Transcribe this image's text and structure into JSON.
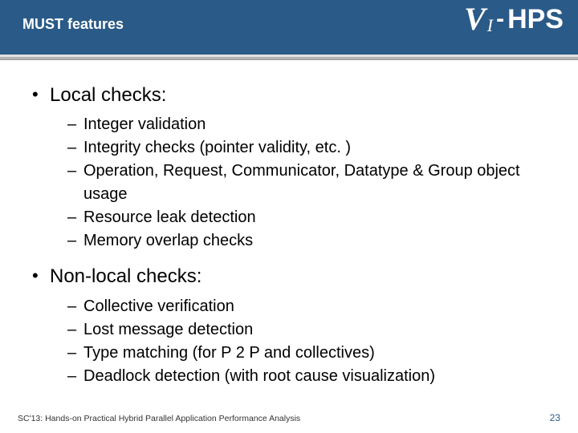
{
  "header": {
    "title": "MUST features",
    "logo": {
      "v": "V",
      "i": "I",
      "dash": "-",
      "hps": "HPS"
    }
  },
  "bullets": {
    "local": {
      "title": "Local checks:",
      "items": [
        "Integer validation",
        "Integrity checks (pointer validity, etc. )",
        "Operation, Request, Communicator, Datatype & Group object usage",
        "Resource leak detection",
        "Memory overlap checks"
      ]
    },
    "nonlocal": {
      "title": "Non-local checks:",
      "items": [
        "Collective verification",
        "Lost message detection",
        "Type matching (for P 2 P and collectives)",
        "Deadlock detection (with root cause visualization)"
      ]
    }
  },
  "footer": {
    "text": "SC'13: Hands-on Practical Hybrid Parallel Application Performance Analysis",
    "page": "23"
  }
}
